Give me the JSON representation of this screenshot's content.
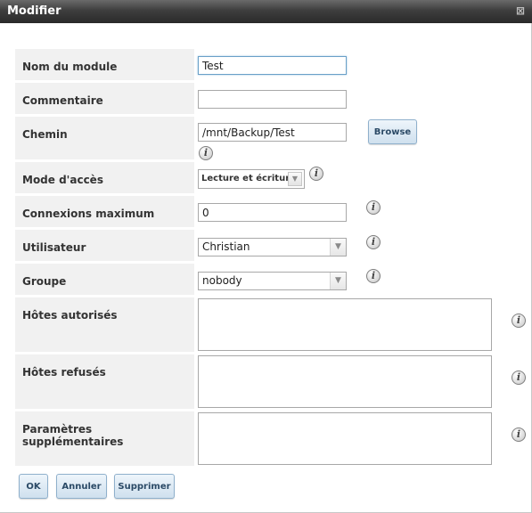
{
  "dialog": {
    "title": "Modifier",
    "close_glyph": "⊠"
  },
  "fields": {
    "module_name": {
      "label": "Nom du module",
      "value": "Test"
    },
    "comment": {
      "label": "Commentaire",
      "value": ""
    },
    "path": {
      "label": "Chemin",
      "value": "/mnt/Backup/Test",
      "browse_label": "Browse"
    },
    "access_mode": {
      "label": "Mode d'accès",
      "value": "Lecture et écriture"
    },
    "max_connections": {
      "label": "Connexions maximum",
      "value": "0"
    },
    "user": {
      "label": "Utilisateur",
      "value": "Christian"
    },
    "group": {
      "label": "Groupe",
      "value": "nobody"
    },
    "hosts_allow": {
      "label": "Hôtes autorisés",
      "value": ""
    },
    "hosts_deny": {
      "label": "Hôtes refusés",
      "value": ""
    },
    "extra_params": {
      "label": "Paramètres supplémentaires",
      "value": ""
    }
  },
  "icons": {
    "info": "i",
    "dropdown_arrow": "▼"
  },
  "buttons": {
    "ok": "OK",
    "cancel": "Annuler",
    "delete": "Supprimer"
  },
  "colors": {
    "title_bar": "#3e3e3e",
    "label_bg": "#f1f1f1",
    "button_bg": "#cfe0ee",
    "button_text": "#2b4a66"
  }
}
